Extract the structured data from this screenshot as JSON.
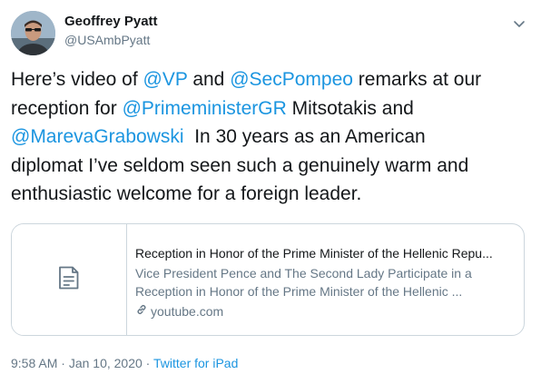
{
  "author": {
    "name": "Geoffrey Pyatt",
    "handle": "@USAmbPyatt"
  },
  "tweet": {
    "line1": {
      "t1": "Here’s video of ",
      "m1": "@VP",
      "t2": " and ",
      "m2": "@SecPompeo",
      "t3": " remarks at our"
    },
    "line2": {
      "t1": "reception for ",
      "m1": "@PrimeministerGR",
      "t2": " Mitsotakis and"
    },
    "line3": {
      "m1": "@MarevaGrabowski",
      "t1": "  In 30 years as an American"
    },
    "line4": "diplomat I’ve seldom seen such a genuinely warm and",
    "line5": "enthusiastic welcome for a foreign leader."
  },
  "card": {
    "title": "Reception in Honor of the Prime Minister of the Hellenic Repu...",
    "desc_line1": "Vice President Pence and The Second Lady Participate in a",
    "desc_line2": "Reception in Honor of the Prime Minister of the Hellenic ...",
    "domain": "youtube.com",
    "thumb_icon": "document-icon",
    "link_icon": "link-icon"
  },
  "meta": {
    "time": "9:58 AM",
    "sep1": " · ",
    "date": "Jan 10, 2020",
    "sep2": " · ",
    "source": "Twitter for iPad"
  },
  "colors": {
    "accent": "#1b95e0",
    "secondary_text": "#657786",
    "border": "#ccd6dd"
  },
  "icons": {
    "menu": "chevron-down-icon"
  }
}
